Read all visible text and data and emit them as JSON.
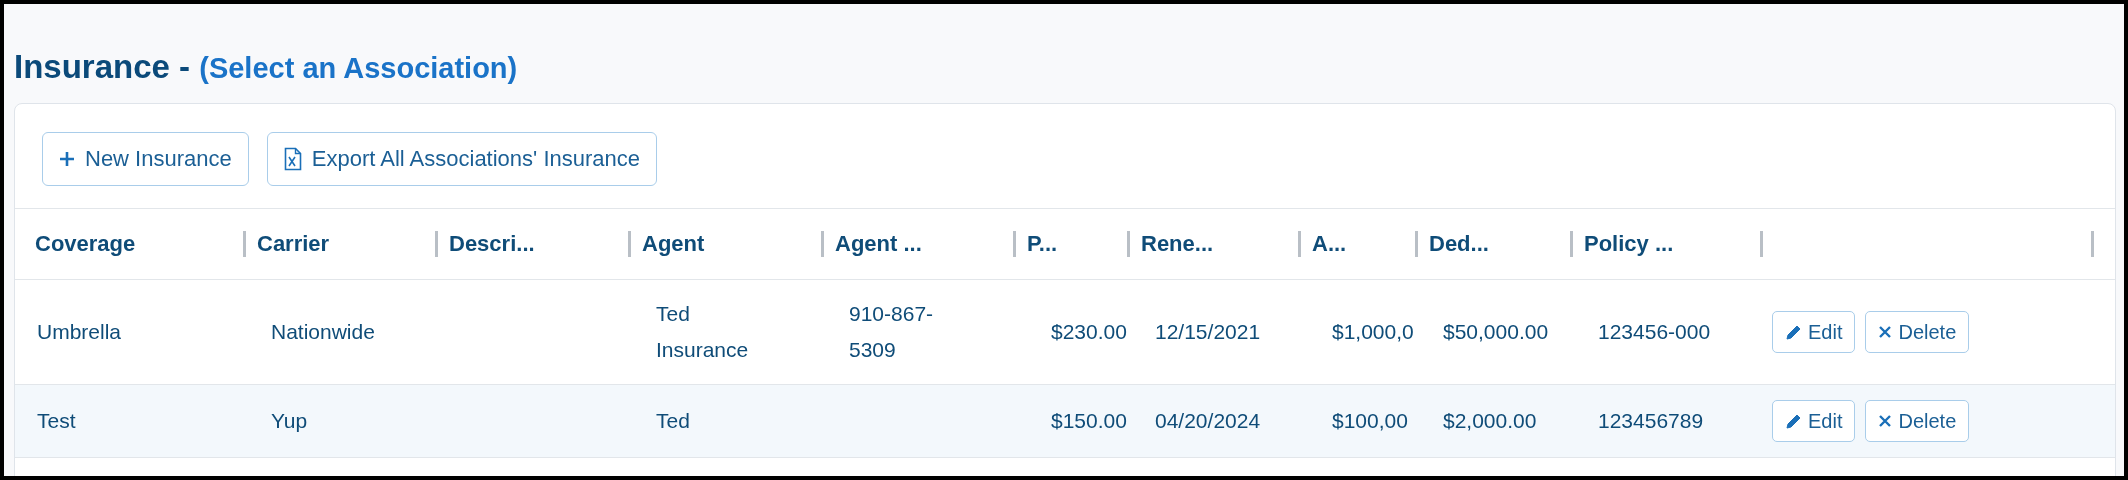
{
  "page_title": {
    "text": "Insurance -",
    "link": "(Select an Association)"
  },
  "toolbar": [
    {
      "kind": "add",
      "label": "New Insurance"
    },
    {
      "kind": "export",
      "label": "Export All Associations' Insurance"
    }
  ],
  "table": {
    "columns": [
      "Coverage",
      "Carrier",
      "Descri...",
      "Agent",
      "Agent ...",
      "P...",
      "Rene...",
      "A...",
      "Ded...",
      "Policy ..."
    ],
    "rows": [
      {
        "cells": [
          "Umbrella",
          "Nationwide",
          "",
          "Ted Insurance",
          "910-867-5309",
          "$230.00",
          "12/15/2021",
          "$1,000,0",
          "$50,000.00",
          "123456-000"
        ],
        "actions": [
          "Edit",
          "Delete"
        ]
      },
      {
        "cells": [
          "Test",
          "Yup",
          "",
          "Ted",
          "",
          "$150.00",
          "04/20/2024",
          "$100,00",
          "$2,000.00",
          "123456789"
        ],
        "actions": [
          "Edit",
          "Delete"
        ]
      }
    ]
  }
}
